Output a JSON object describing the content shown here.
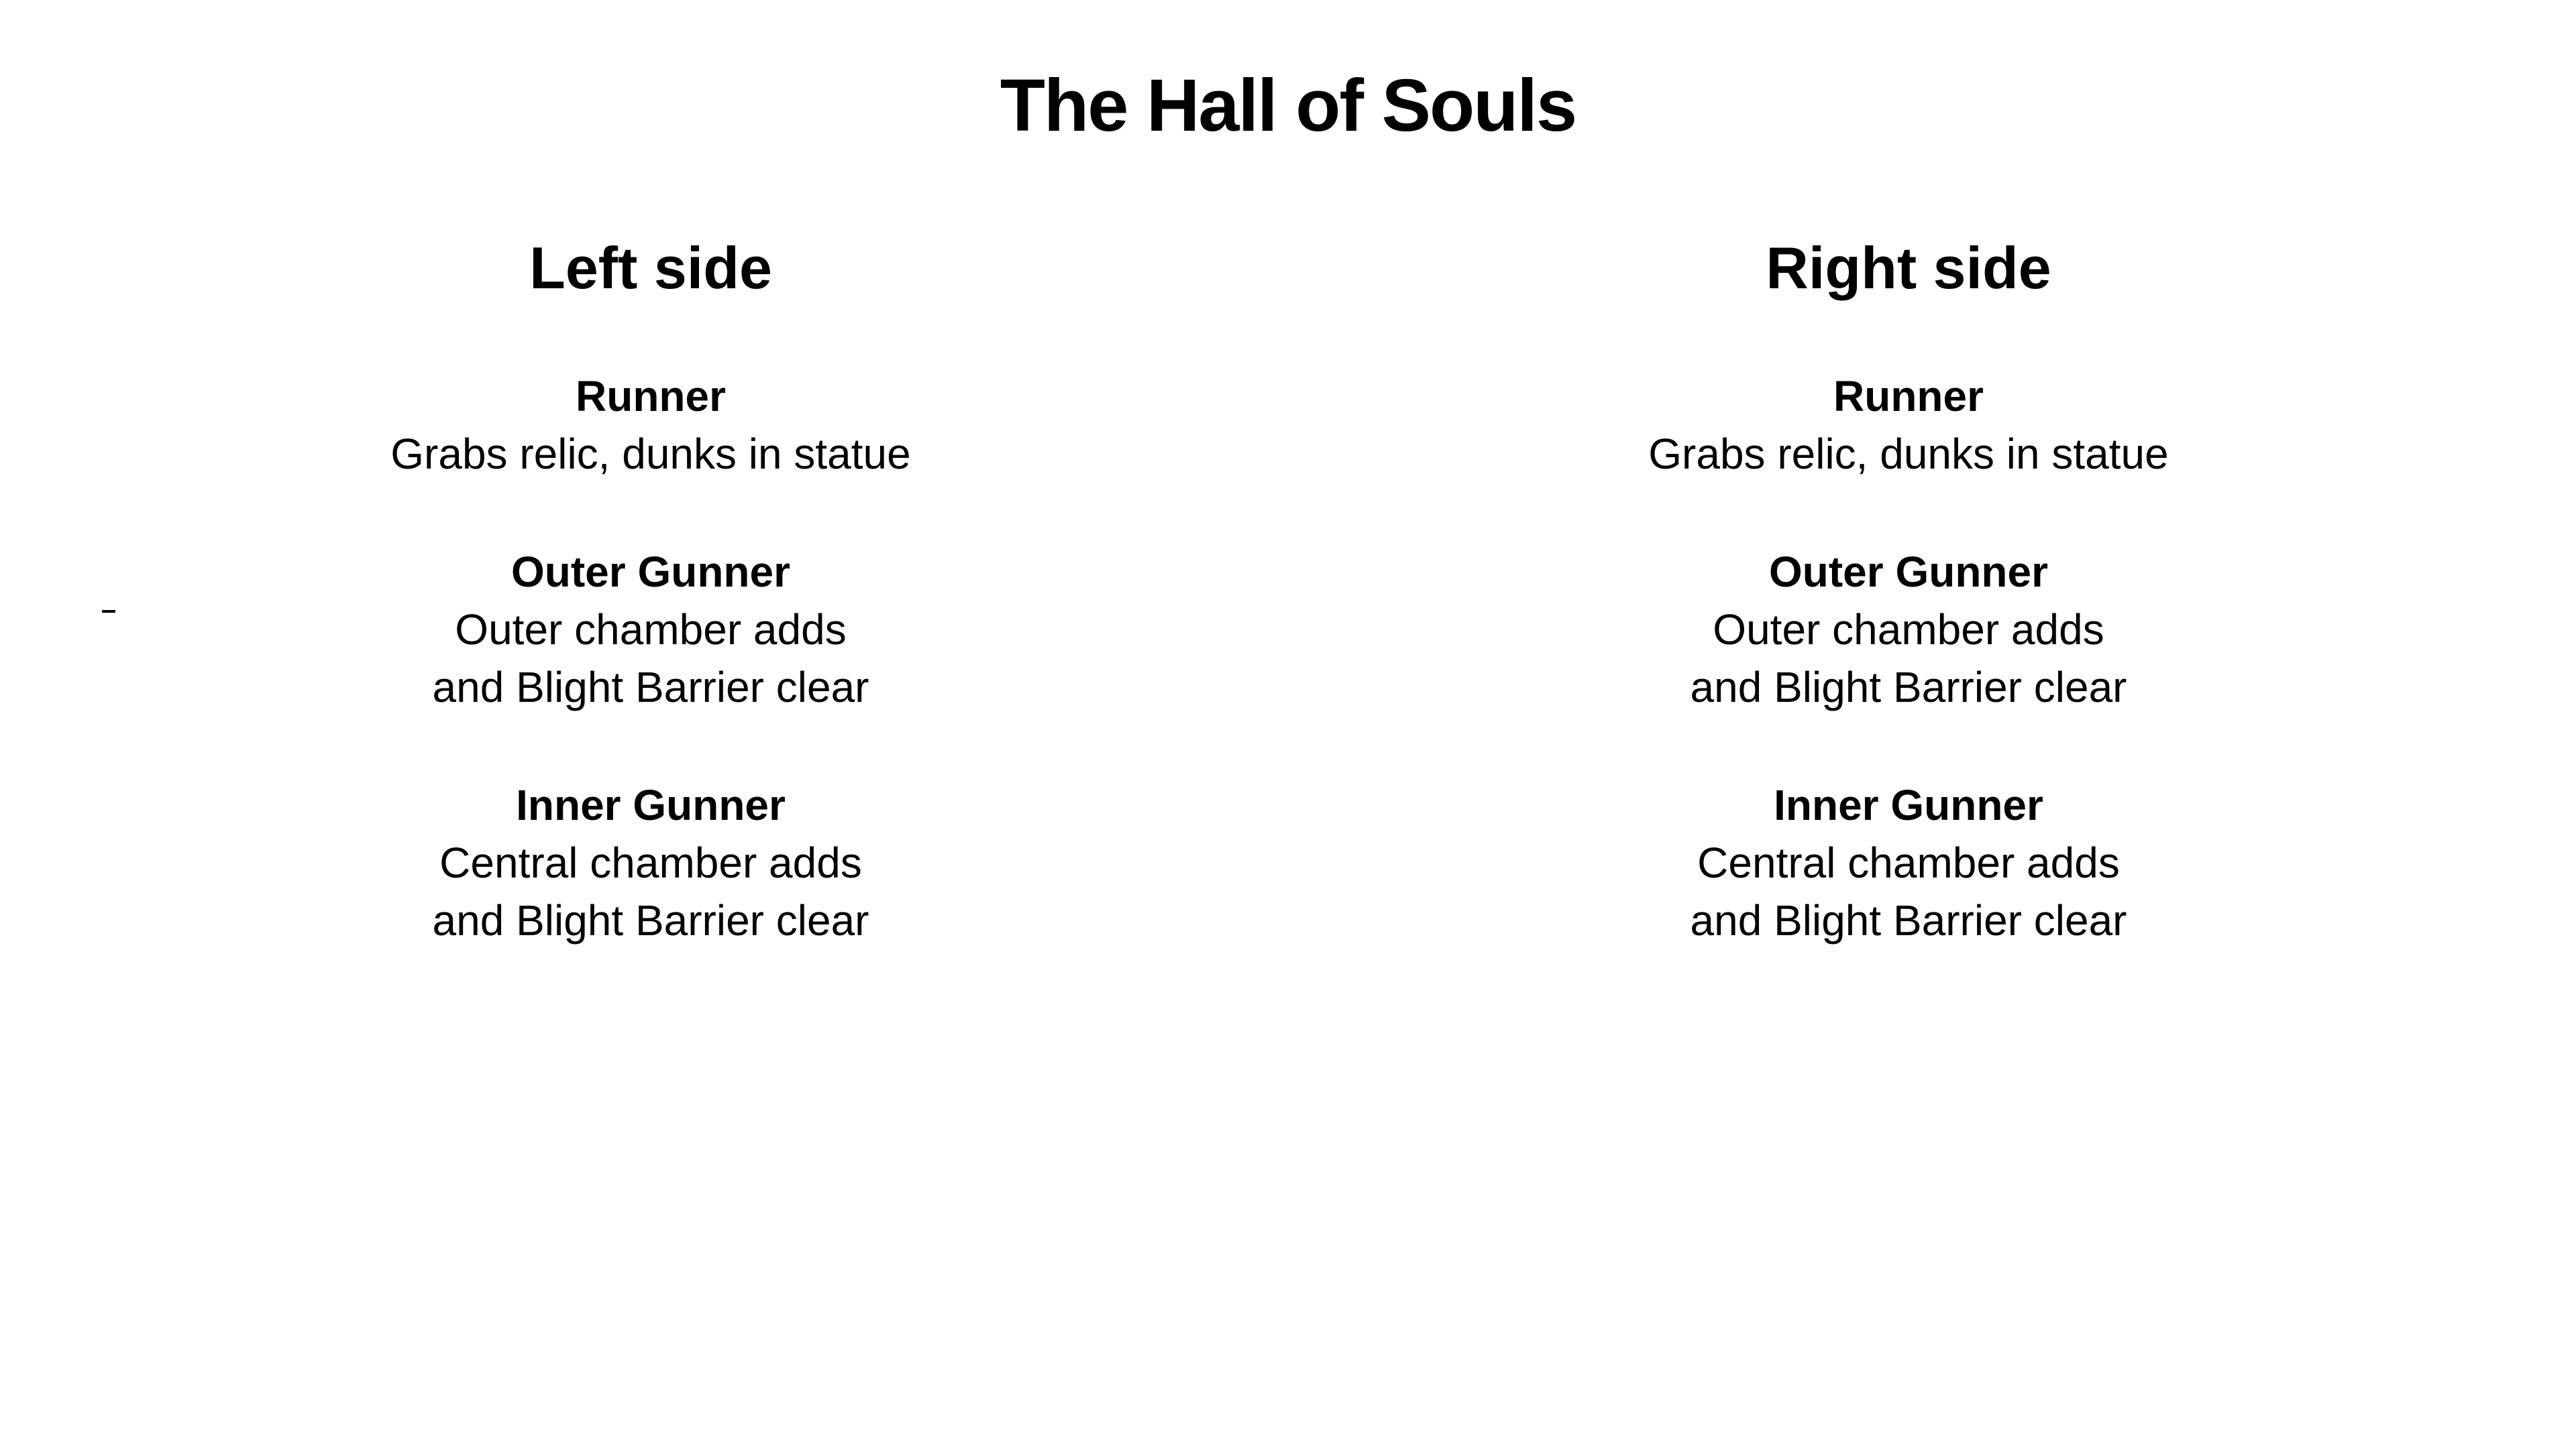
{
  "title": "The Hall of Souls",
  "left": {
    "heading": "Left side",
    "roles": [
      {
        "name": "Runner",
        "desc": "Grabs relic, dunks in statue"
      },
      {
        "name": "Outer Gunner",
        "desc": "Outer chamber adds\nand Blight Barrier clear"
      },
      {
        "name": "Inner Gunner",
        "desc": "Central chamber adds\nand Blight Barrier clear"
      }
    ]
  },
  "right": {
    "heading": "Right side",
    "roles": [
      {
        "name": "Runner",
        "desc": "Grabs relic, dunks in statue"
      },
      {
        "name": "Outer Gunner",
        "desc": "Outer chamber adds\nand Blight Barrier clear"
      },
      {
        "name": "Inner Gunner",
        "desc": "Central chamber adds\nand Blight Barrier clear"
      }
    ]
  }
}
